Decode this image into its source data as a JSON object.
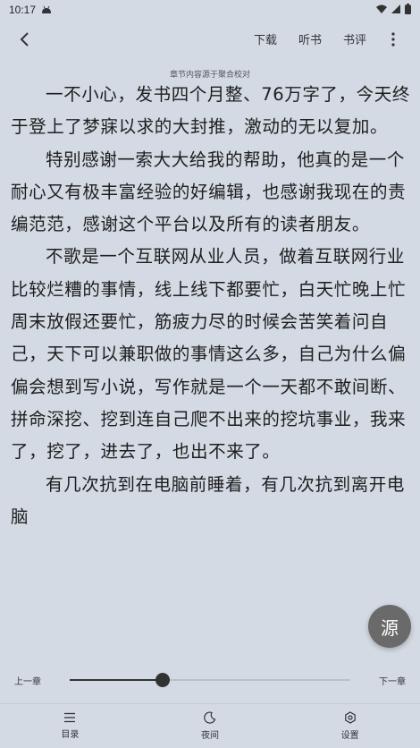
{
  "status": {
    "time": "10:17"
  },
  "toolbar": {
    "download": "下载",
    "listen": "听书",
    "review": "书评"
  },
  "source_note": "章节内容源于聚合校对",
  "paragraphs": [
    "一不小心，发书四个月整、76万字了，今天终于登上了梦寐以求的大封推，激动的无以复加。",
    "特别感谢一索大大给我的帮助，他真的是一个耐心又有极丰富经验的好编辑，也感谢我现在的责编范范，感谢这个平台以及所有的读者朋友。",
    "不歌是一个互联网从业人员，做着互联网行业比较烂糟的事情，线上线下都要忙，白天忙晚上忙周末放假还要忙，筋疲力尽的时候会苦笑着问自己，天下可以兼职做的事情这么多，自己为什么偏偏会想到写小说，写作就是一个一天都不敢间断、拼命深挖、挖到连自己爬不出来的挖坑事业，我来了，挖了，进去了，也出不来了。",
    "有几次抗到在电脑前睡着，有几次抗到离开电脑"
  ],
  "source_button": "源",
  "chapter_nav": {
    "prev": "上一章",
    "next": "下一章",
    "progress": 0.33
  },
  "bottom_nav": {
    "toc": "目录",
    "night": "夜间",
    "settings": "设置"
  }
}
